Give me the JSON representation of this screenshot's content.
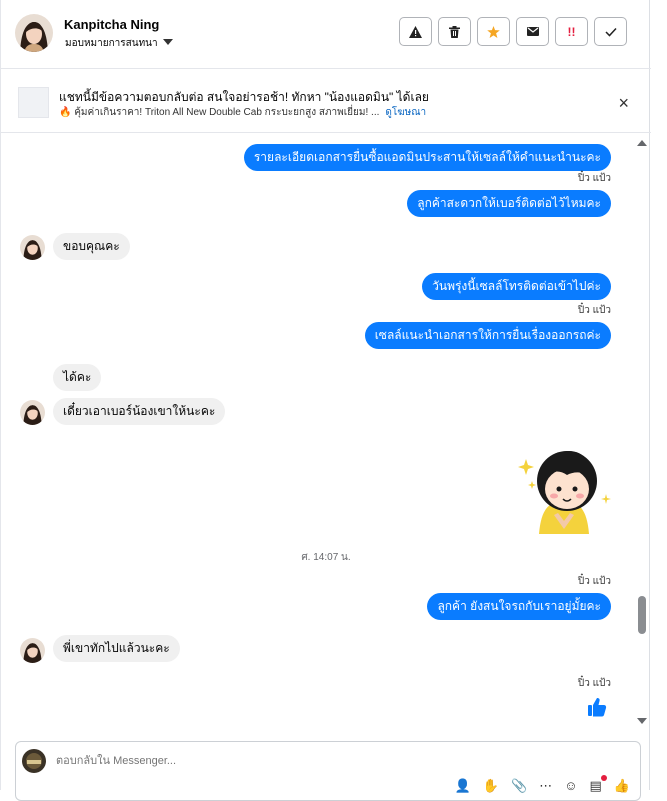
{
  "header": {
    "name": "Kanpitcha Ning",
    "assign_label": "มอบหมายการสนทนา",
    "actions": [
      {
        "icon": "warning-icon",
        "glyph": "⚠"
      },
      {
        "icon": "trash-icon",
        "glyph": "🗑"
      },
      {
        "icon": "star-icon",
        "glyph": "★"
      },
      {
        "icon": "mail-icon",
        "glyph": "✉"
      },
      {
        "icon": "spam-icon",
        "glyph": "!!"
      },
      {
        "icon": "check-icon",
        "glyph": "✓"
      }
    ]
  },
  "ad": {
    "title": "แชทนี้มีข้อความตอบกลับต่อ สนใจอย่ารอช้า! ทักหา \"น้องแอดมิน\" ได้เลย",
    "subtitle": "🔥 คุ้มค่าเกินราคา! Triton All New Double Cab กระบะยกสูง สภาพเยี่ยม! ...",
    "link": "ดูโฆษณา",
    "close": "×"
  },
  "thread": {
    "m1": "รายละเอียดเอกสารยื่นซื้อแอดมินประสานให้เซลล์ให้คำแนะนำนะคะ",
    "seen1": "ปิ๋ว แป้ว",
    "m2": "ลูกค้าสะดวกให้เบอร์ติดต่อไว้ไหมคะ",
    "m3": "ขอบคุณคะ",
    "m4": "วันพรุ่งนี้เซลล์โทรติดต่อเข้าไปค่ะ",
    "seen2": "ปิ๋ว แป้ว",
    "m5": "เซลล์แนะนำเอกสารให้การยื่นเรื่องออกรถค่ะ",
    "m6": "ได้คะ",
    "m7": "เดี๋ยวเอาเบอร์น้องเขาให้นะคะ",
    "timestamp": "ศ. 14:07 น.",
    "seen3": "ปิ๋ว แป้ว",
    "m8": "ลูกค้า ยังสนใจรถกับเราอยู่มั้ยคะ",
    "m9": "พี่เขาทักไปแล้วนะคะ",
    "seen4": "ปิ๋ว แป้ว"
  },
  "composer": {
    "placeholder": "ตอบกลับใน Messenger..."
  },
  "colors": {
    "accent": "#0a7cff",
    "incoming": "#f0f0f0"
  }
}
